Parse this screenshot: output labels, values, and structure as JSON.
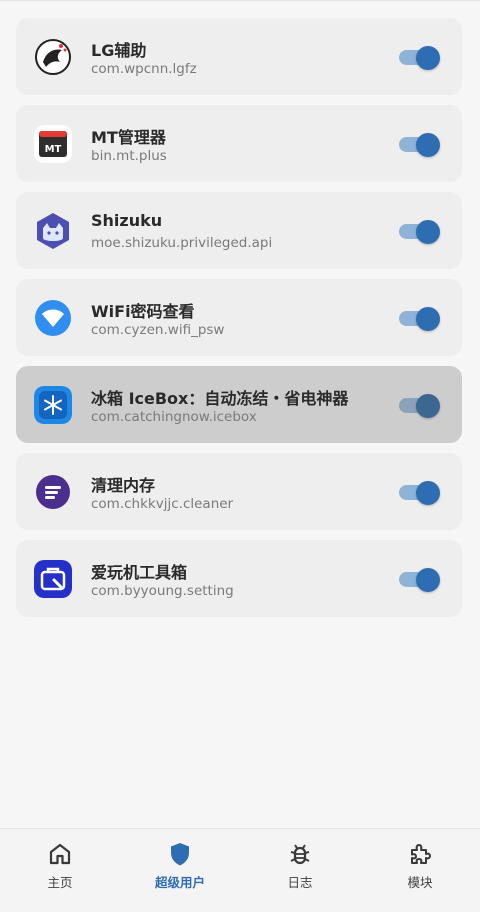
{
  "colors": {
    "accent": "#2f6db2",
    "card_bg": "#eeeeee",
    "card_pressed_bg": "#cdcdcd",
    "switch_track": "#8fb3d6"
  },
  "apps": [
    {
      "name": "LG辅助",
      "package": "com.wpcnn.lgfz",
      "icon": "lg-helper-icon",
      "enabled": true
    },
    {
      "name": "MT管理器",
      "package": "bin.mt.plus",
      "icon": "mt-manager-icon",
      "enabled": true
    },
    {
      "name": "Shizuku",
      "package": "moe.shizuku.privileged.api",
      "icon": "shizuku-icon",
      "enabled": true
    },
    {
      "name": "WiFi密码查看",
      "package": "com.cyzen.wifi_psw",
      "icon": "wifi-icon",
      "enabled": true
    },
    {
      "name": "冰箱 IceBox：自动冻结・省电神器",
      "package": "com.catchingnow.icebox",
      "icon": "icebox-icon",
      "enabled": true,
      "pressed": true
    },
    {
      "name": "清理内存",
      "package": "com.chkkvjjc.cleaner",
      "icon": "cleaner-icon",
      "enabled": true
    },
    {
      "name": "爱玩机工具箱",
      "package": "com.byyoung.setting",
      "icon": "toolbox-icon",
      "enabled": true
    }
  ],
  "nav": {
    "items": [
      {
        "label": "主页",
        "icon": "home-icon"
      },
      {
        "label": "超级用户",
        "icon": "shield-icon",
        "active": true
      },
      {
        "label": "日志",
        "icon": "bug-icon"
      },
      {
        "label": "模块",
        "icon": "puzzle-icon"
      }
    ]
  }
}
